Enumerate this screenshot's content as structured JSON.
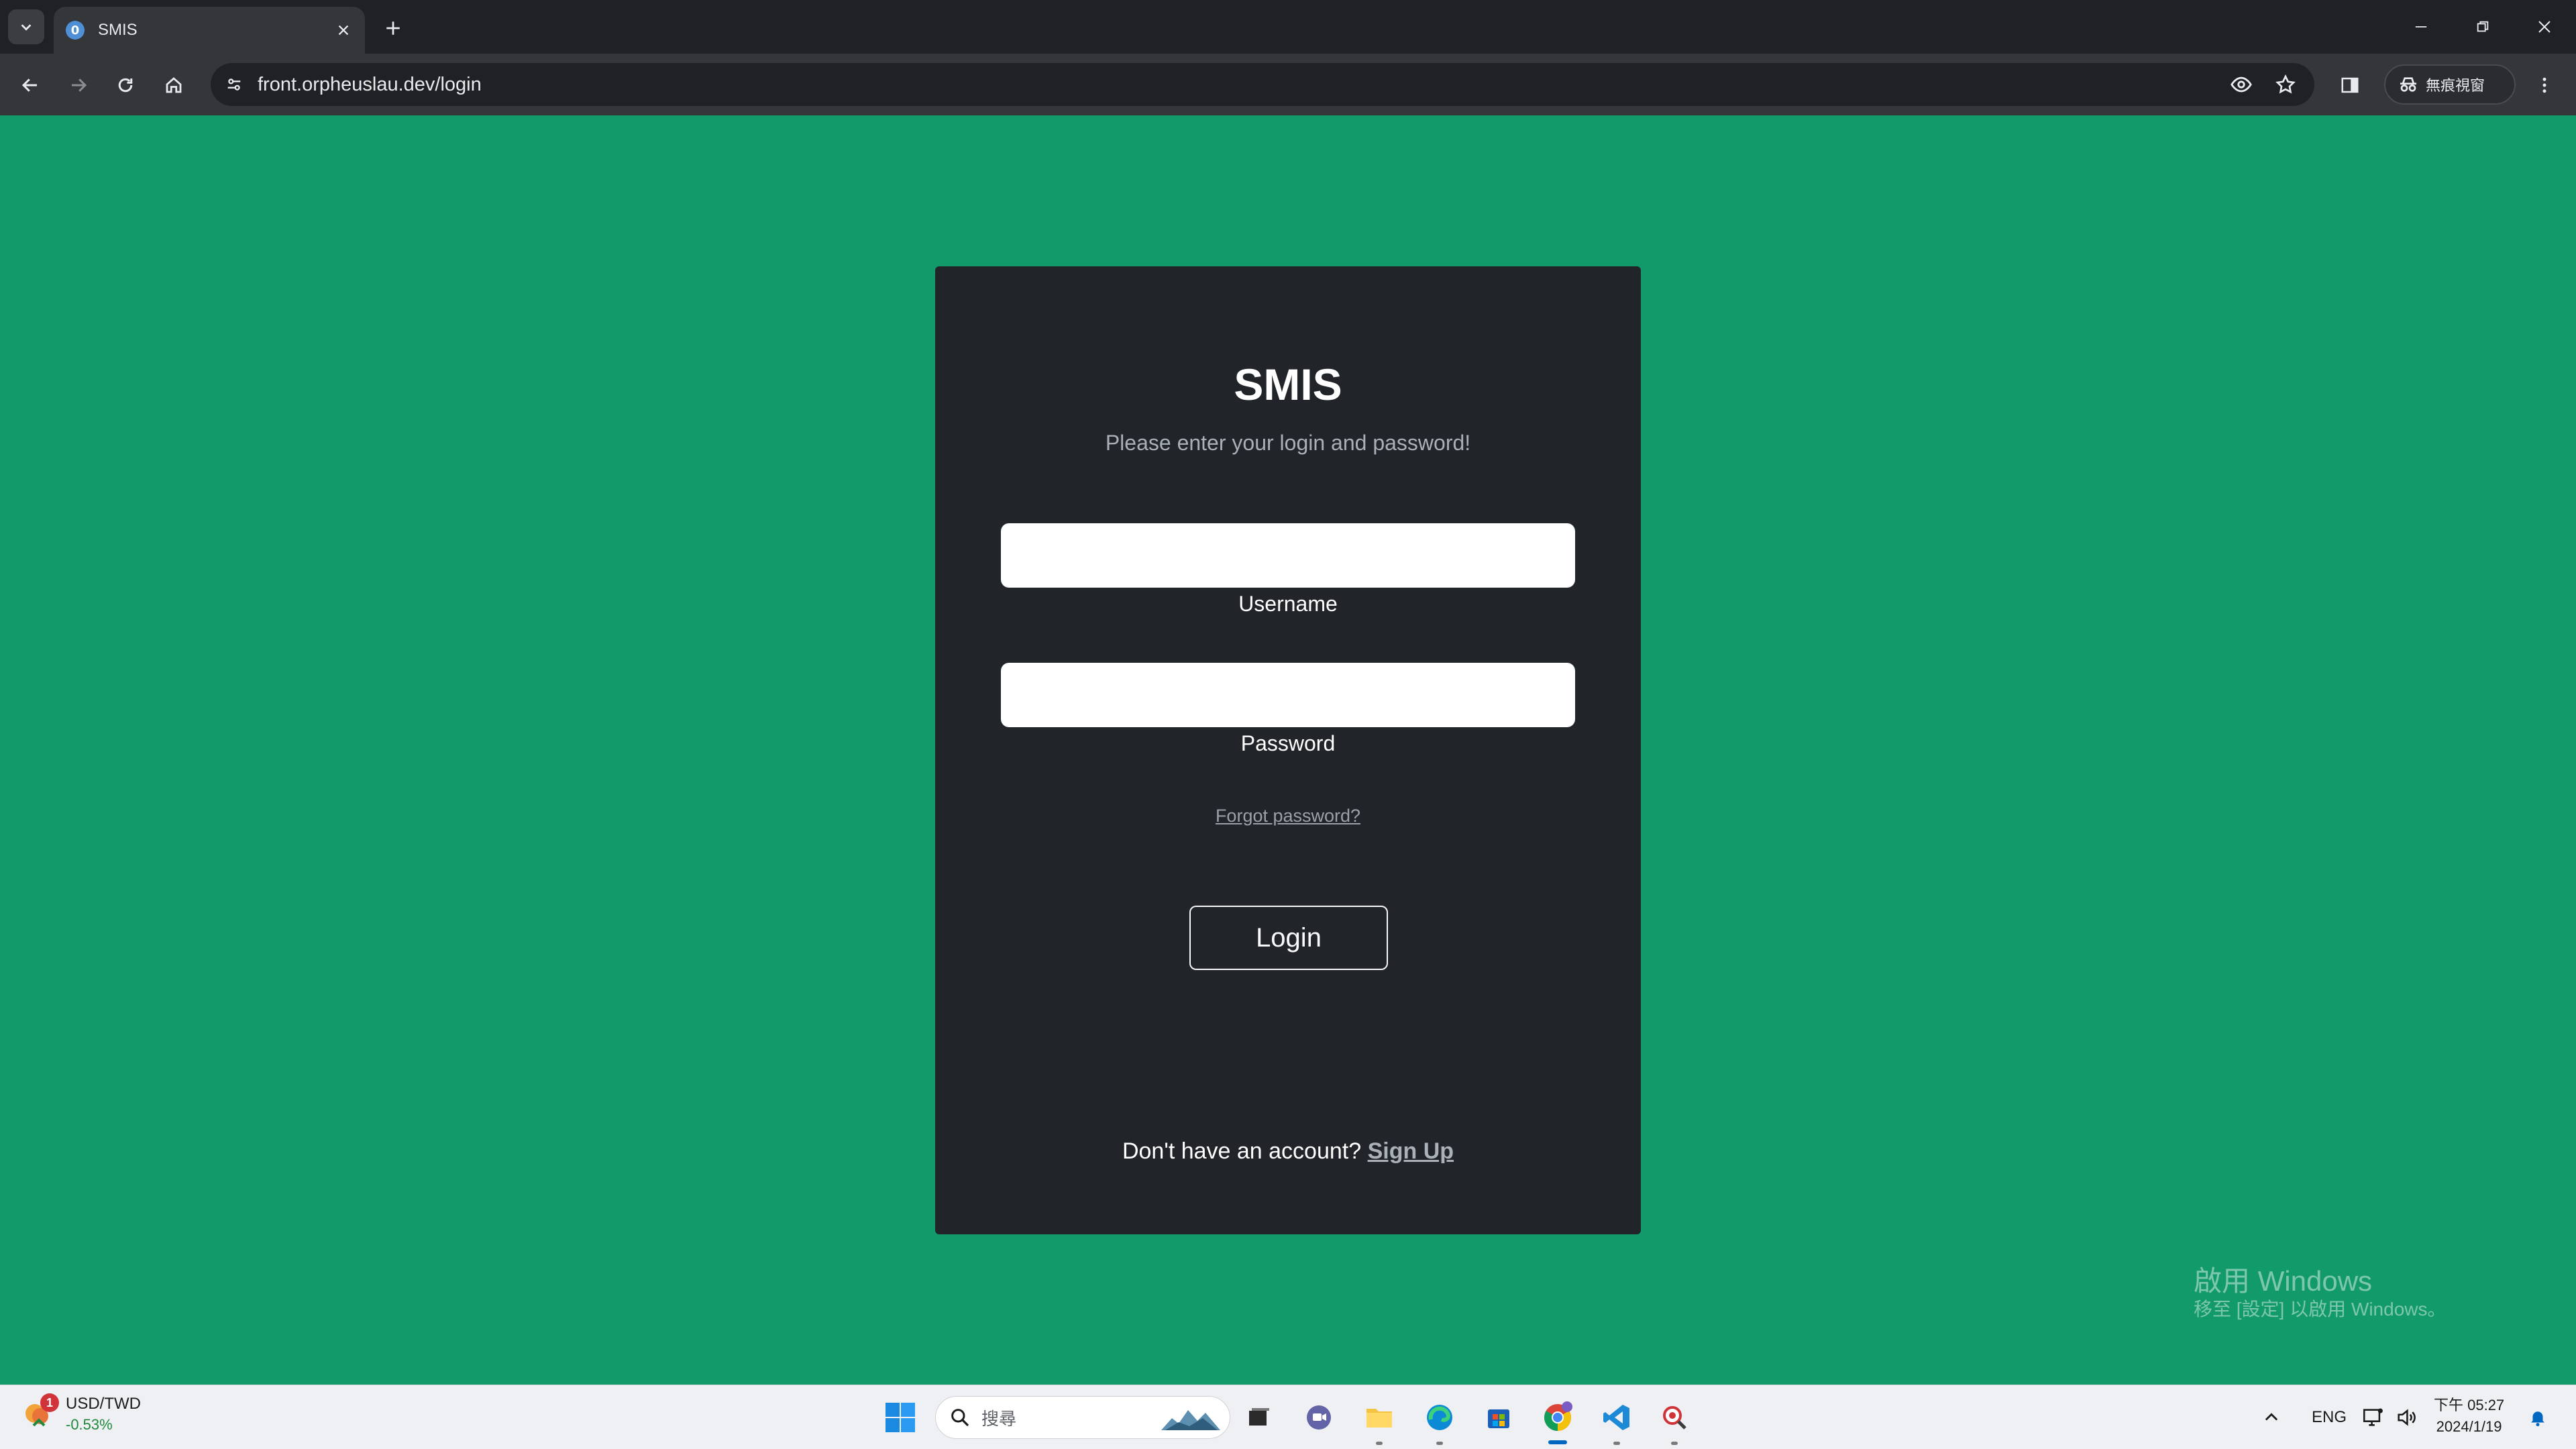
{
  "browser": {
    "tab_title": "SMIS",
    "favicon_letter": "0",
    "url": "front.orpheuslau.dev/login",
    "incognito_label": "無痕視窗"
  },
  "login": {
    "brand": "SMIS",
    "subtitle": "Please enter your login and password!",
    "username_label": "Username",
    "username_value": "",
    "password_label": "Password",
    "password_value": "",
    "forgot_link": "Forgot password?",
    "login_button": "Login",
    "signup_prompt": "Don't have an account?",
    "signup_link": "Sign Up"
  },
  "watermark": {
    "line1": "啟用 Windows",
    "line2": "移至 [設定] 以啟用 Windows。"
  },
  "taskbar": {
    "widget_badge": "1",
    "widget_pair": "USD/TWD",
    "widget_change": "-0.53%",
    "search_placeholder": "搜尋",
    "language": "ENG",
    "time": "下午 05:27",
    "date": "2024/1/19"
  },
  "colors": {
    "page_background": "#129a6a",
    "card_background": "#212529",
    "chrome_dark": "#202124",
    "chrome_toolbar": "#35363a"
  },
  "icons": {
    "tab_menu": "chevron-down-icon",
    "tab_close": "close-icon",
    "new_tab": "plus-icon",
    "back": "arrow-left-icon",
    "forward": "arrow-right-icon",
    "reload": "reload-icon",
    "home": "home-icon",
    "site_info": "tune-icon",
    "eye": "eye-icon",
    "bookmark": "star-icon",
    "side_panel": "side-panel-icon",
    "incognito": "incognito-icon",
    "menu": "kebab-menu-icon"
  }
}
